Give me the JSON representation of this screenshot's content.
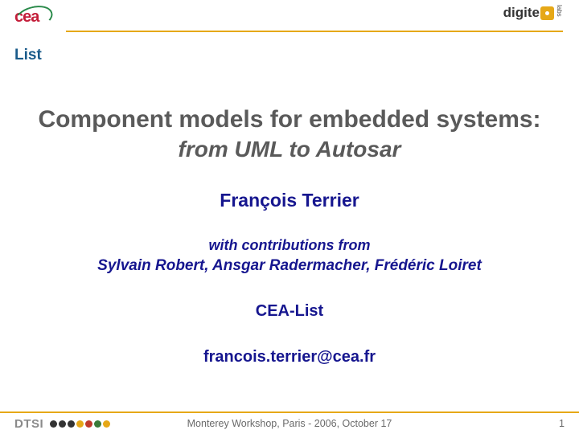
{
  "header": {
    "logo_cea": "cea",
    "logo_list_text": "List",
    "logo_digiteo_text": "digite",
    "logo_digiteo_labs": "labs"
  },
  "content": {
    "title": "Component models for embedded systems:",
    "subtitle": "from UML to Autosar",
    "author": "François Terrier",
    "contrib_intro": "with contributions from",
    "contributors": "Sylvain Robert, Ansgar Radermacher, Frédéric Loiret",
    "organization": "CEA-List",
    "email": "francois.terrier@cea.fr"
  },
  "footer": {
    "left": "DTSI",
    "center": "Monterey Workshop, Paris - 2006, October 17",
    "page": "1"
  }
}
